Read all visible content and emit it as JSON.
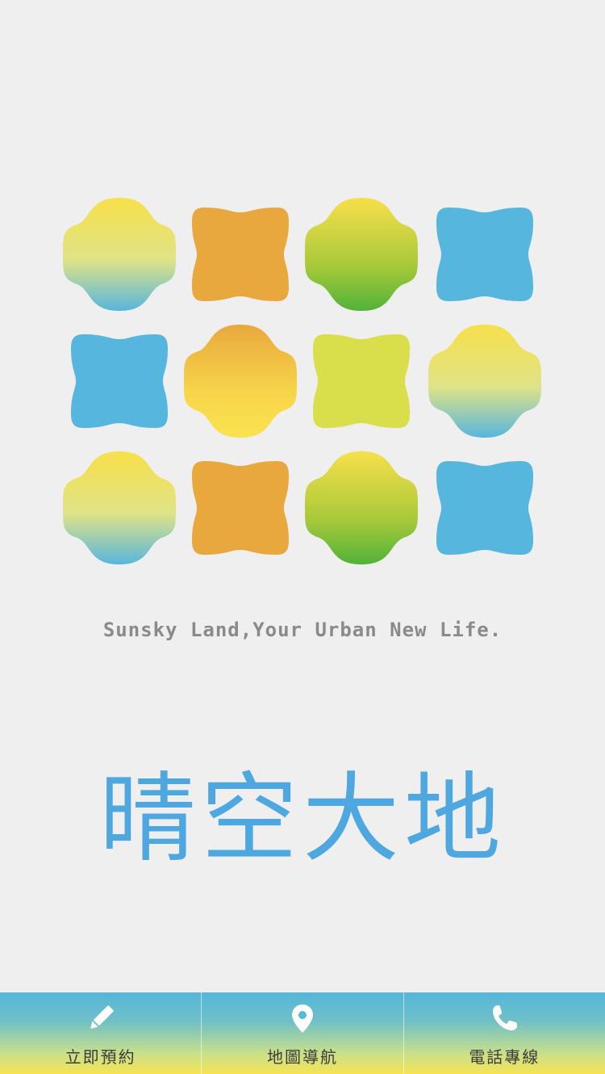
{
  "tagline": "Sunsky Land,Your Urban New Life.",
  "brand_title": "晴空大地",
  "logo": {
    "tiles": [
      {
        "shape": "flower",
        "fill": "yellow-blue"
      },
      {
        "shape": "square",
        "fill": "orange"
      },
      {
        "shape": "flower",
        "fill": "yellow-green"
      },
      {
        "shape": "square",
        "fill": "blue"
      },
      {
        "shape": "square",
        "fill": "blue"
      },
      {
        "shape": "flower",
        "fill": "orange-yellow"
      },
      {
        "shape": "square",
        "fill": "lime"
      },
      {
        "shape": "flower",
        "fill": "yellow-blue"
      },
      {
        "shape": "flower",
        "fill": "yellow-blue"
      },
      {
        "shape": "square",
        "fill": "orange"
      },
      {
        "shape": "flower",
        "fill": "yellow-green"
      },
      {
        "shape": "square",
        "fill": "blue"
      }
    ],
    "colors": {
      "yellow": "#f6e04a",
      "blue": "#57b6dd",
      "orange": "#e9a83e",
      "green": "#5eb43d",
      "lime": "#d8df4a"
    }
  },
  "bottom_nav": {
    "items": [
      {
        "label": "立即預約",
        "icon": "pencil-icon"
      },
      {
        "label": "地圖導航",
        "icon": "map-pin-icon"
      },
      {
        "label": "電話專線",
        "icon": "phone-icon"
      }
    ],
    "gradient_top": "#56b6da",
    "gradient_bottom": "#f7e353"
  }
}
